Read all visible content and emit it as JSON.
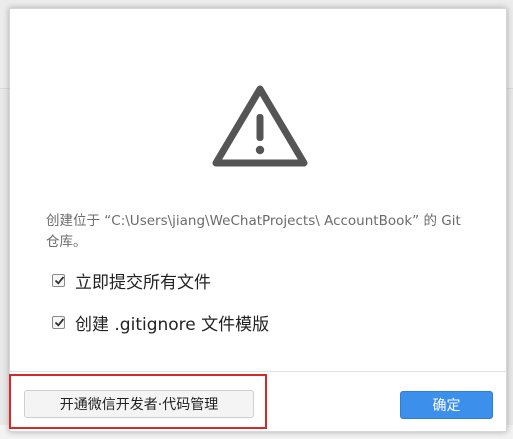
{
  "dialog": {
    "message": "创建位于 “C:\\Users\\jiang\\WeChatProjects\\ AccountBook” 的 Git 仓库。",
    "options": [
      {
        "label": "立即提交所有文件",
        "checked": true
      },
      {
        "label": "创建 .gitignore 文件模版",
        "checked": true
      }
    ],
    "buttons": {
      "secondary_label": "开通微信开发者·代码管理",
      "primary_label": "确定"
    }
  },
  "icons": {
    "warning": "warning-triangle-icon",
    "check": "check-icon"
  },
  "colors": {
    "primary_button": "#3c8fea",
    "highlight_border": "#d42a2a",
    "warning_icon": "#555555"
  }
}
